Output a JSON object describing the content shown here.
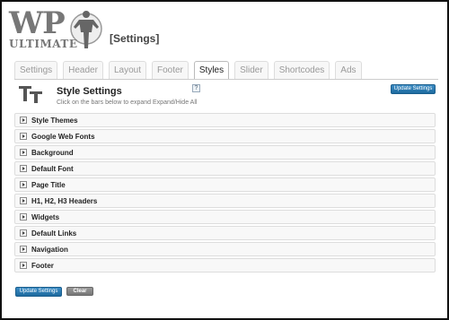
{
  "header": {
    "logo_wp": "WP",
    "logo_ultimate": "ULTIMATE",
    "page_heading": "[Settings]"
  },
  "tabs": [
    {
      "label": "Settings",
      "active": false
    },
    {
      "label": "Header",
      "active": false
    },
    {
      "label": "Layout",
      "active": false
    },
    {
      "label": "Footer",
      "active": false
    },
    {
      "label": "Styles",
      "active": true
    },
    {
      "label": "Slider",
      "active": false
    },
    {
      "label": "Shortcodes",
      "active": false
    },
    {
      "label": "Ads",
      "active": false
    }
  ],
  "section": {
    "icon": "tt-icon",
    "title": "Style Settings",
    "help": "?",
    "subtitle": "Click on the bars below to expand Expand/Hide All",
    "update_label": "Update Settings"
  },
  "bars": [
    {
      "label": "Style Themes"
    },
    {
      "label": "Google Web Fonts"
    },
    {
      "label": "Background"
    },
    {
      "label": "Default Font"
    },
    {
      "label": "Page Title"
    },
    {
      "label": "H1, H2, H3 Headers"
    },
    {
      "label": "Widgets"
    },
    {
      "label": "Default Links"
    },
    {
      "label": "Navigation"
    },
    {
      "label": "Footer"
    }
  ],
  "footer": {
    "update_label": "Update Settings",
    "clear_label": "Clear"
  },
  "colors": {
    "accent": "#2a7ab5",
    "clear": "#888888"
  }
}
